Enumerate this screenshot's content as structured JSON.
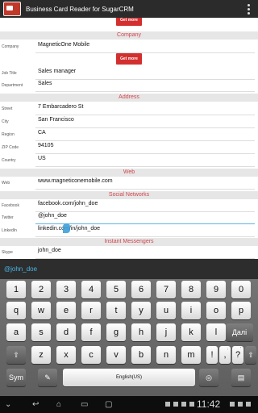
{
  "app": {
    "title": "Business Card Reader for SugarCRM",
    "icon": "app-logo-icon"
  },
  "buttons": {
    "get_more_1": "Get more",
    "get_more_2": "Get more"
  },
  "sections": {
    "company": "Company",
    "address": "Address",
    "web": "Web",
    "social": "Social Networks",
    "im": "Instant Messengers"
  },
  "fields": {
    "company": {
      "label": "Company",
      "value": "MagneticOne Mobile"
    },
    "job_title": {
      "label": "Job Title",
      "value": "Sales manager"
    },
    "department": {
      "label": "Department",
      "value": "Sales"
    },
    "street": {
      "label": "Street",
      "value": "7 Embarcadero St"
    },
    "city": {
      "label": "City",
      "value": "San Francisco"
    },
    "region": {
      "label": "Region",
      "value": "CA"
    },
    "zip": {
      "label": "ZIP Code",
      "value": "94105"
    },
    "country": {
      "label": "Country",
      "value": "US"
    },
    "web": {
      "label": "Web",
      "value": "www.magneticonemobile.com"
    },
    "facebook": {
      "label": "Facebook",
      "value": "facebook.com/john_doe"
    },
    "twitter": {
      "label": "Twitter",
      "value": "@john_doe"
    },
    "linkedin": {
      "label": "LinkedIn",
      "value": "linkedin.com/in/john_doe"
    },
    "skype": {
      "label": "Skype",
      "value": "john_doe"
    }
  },
  "suggestion": "@john_doe",
  "keyboard": {
    "row1": [
      "1",
      "2",
      "3",
      "4",
      "5",
      "6",
      "7",
      "8",
      "9",
      "0"
    ],
    "row2": [
      "q",
      "w",
      "e",
      "r",
      "t",
      "y",
      "u",
      "i",
      "o",
      "p"
    ],
    "row3": [
      "a",
      "s",
      "d",
      "f",
      "g",
      "h",
      "j",
      "k",
      "l"
    ],
    "row4": [
      "z",
      "x",
      "c",
      "v",
      "b",
      "n",
      "m",
      "!",
      ",",
      "?"
    ],
    "row4_sub": [
      "",
      "",
      "",
      "",
      "",
      "",
      "",
      "",
      ":",
      "'"
    ],
    "enter": "Далі",
    "sym": "Sym",
    "space": "English(US)"
  },
  "statusbar": {
    "time": "11:42"
  },
  "colors": {
    "accent": "#d32f2f",
    "section_text": "#d0454d",
    "suggest": "#49b5e7"
  }
}
